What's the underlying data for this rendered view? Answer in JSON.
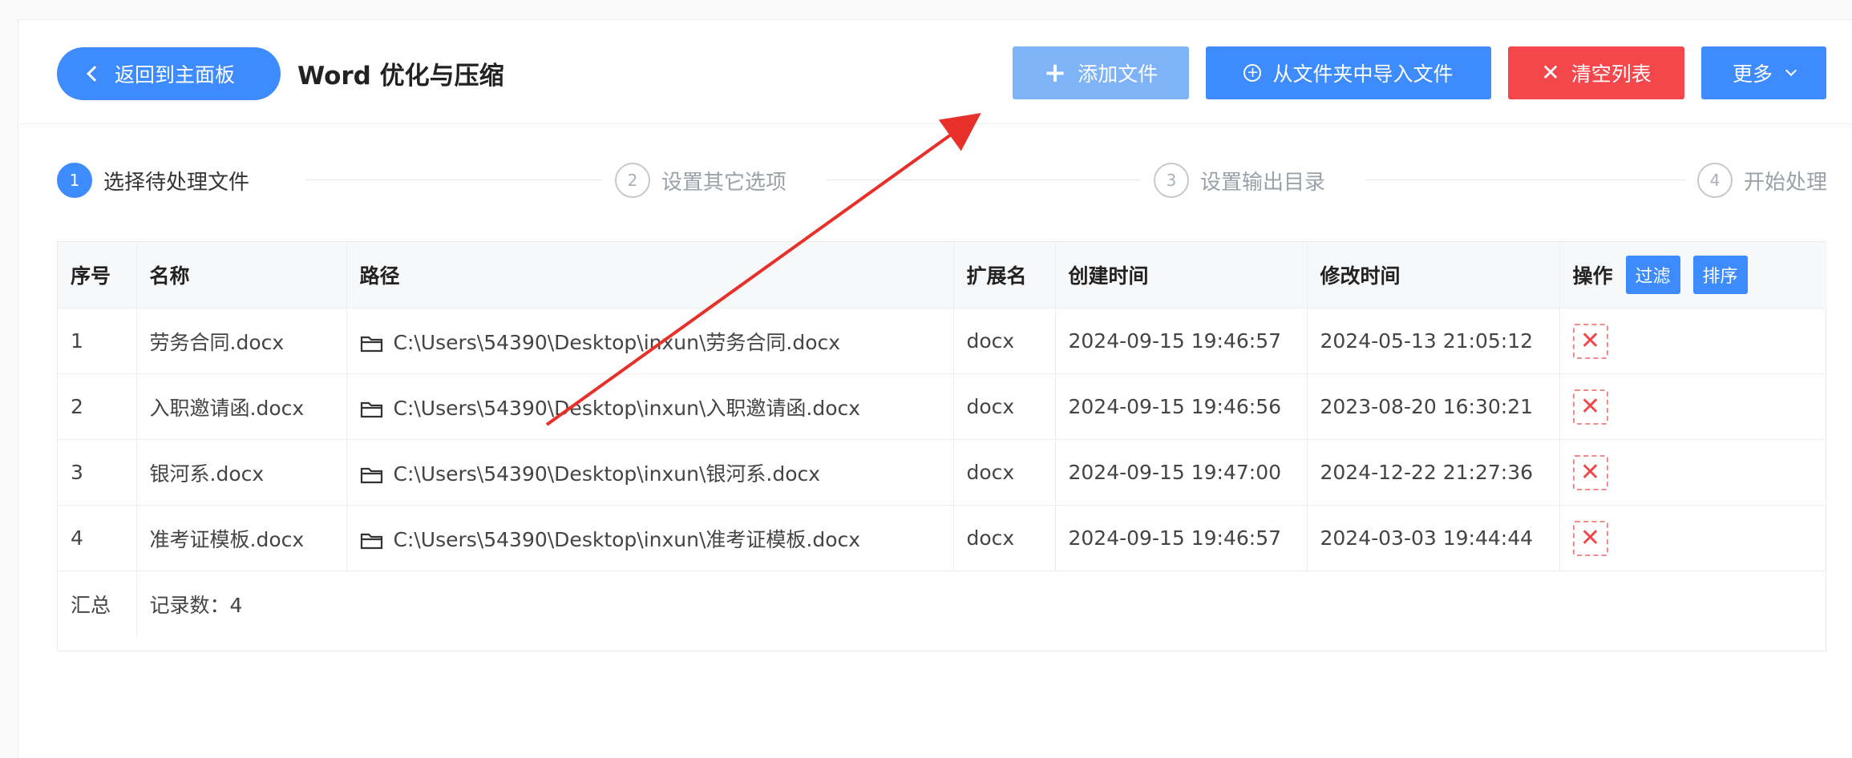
{
  "header": {
    "back_label": "返回到主面板",
    "title": "Word 优化与压缩",
    "add_file_label": "添加文件",
    "import_folder_label": "从文件夹中导入文件",
    "clear_list_label": "清空列表",
    "more_label": "更多"
  },
  "steps": [
    {
      "num": "1",
      "label": "选择待处理文件",
      "active": true
    },
    {
      "num": "2",
      "label": "设置其它选项",
      "active": false
    },
    {
      "num": "3",
      "label": "设置输出目录",
      "active": false
    },
    {
      "num": "4",
      "label": "开始处理",
      "active": false
    }
  ],
  "table": {
    "columns": {
      "index": "序号",
      "name": "名称",
      "path": "路径",
      "ext": "扩展名",
      "created": "创建时间",
      "modified": "修改时间",
      "ops": "操作"
    },
    "filter_label": "过滤",
    "sort_label": "排序",
    "rows": [
      {
        "index": "1",
        "name": "劳务合同.docx",
        "path": "C:\\Users\\54390\\Desktop\\inxun\\劳务合同.docx",
        "ext": "docx",
        "created": "2024-09-15 19:46:57",
        "modified": "2024-05-13 21:05:12"
      },
      {
        "index": "2",
        "name": "入职邀请函.docx",
        "path": "C:\\Users\\54390\\Desktop\\inxun\\入职邀请函.docx",
        "ext": "docx",
        "created": "2024-09-15 19:46:56",
        "modified": "2023-08-20 16:30:21"
      },
      {
        "index": "3",
        "name": "银河系.docx",
        "path": "C:\\Users\\54390\\Desktop\\inxun\\银河系.docx",
        "ext": "docx",
        "created": "2024-09-15 19:47:00",
        "modified": "2024-12-22 21:27:36"
      },
      {
        "index": "4",
        "name": "准考证模板.docx",
        "path": "C:\\Users\\54390\\Desktop\\inxun\\准考证模板.docx",
        "ext": "docx",
        "created": "2024-09-15 19:46:57",
        "modified": "2024-03-03 19:44:44"
      }
    ],
    "summary_label": "汇总",
    "summary_value": "记录数：4"
  },
  "colors": {
    "primary": "#3d8bfd",
    "primary_light": "#7fb3f7",
    "danger": "#f4474c",
    "annotation_arrow": "#e8302a"
  },
  "icons": {
    "back": "chevron-left-icon",
    "add": "plus-icon",
    "import": "circle-plus-icon",
    "clear": "close-icon",
    "more": "chevron-down-icon",
    "path": "folder-icon",
    "delete": "delete-x-icon"
  }
}
